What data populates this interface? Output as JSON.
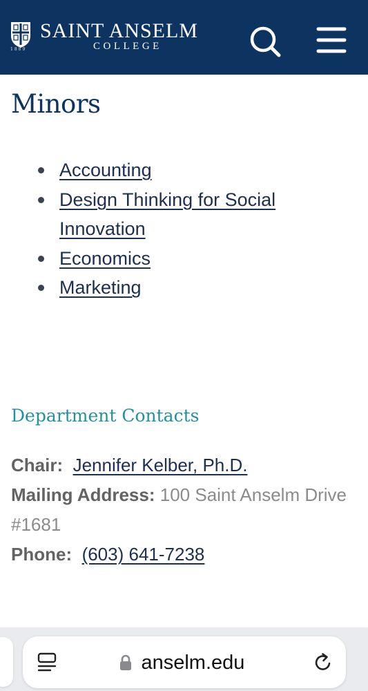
{
  "header": {
    "logo_name": "SAINT ANSELM",
    "logo_sub": "COLLEGE",
    "logo_year": "1889",
    "background_color": "#0d3361",
    "search_icon": "search-icon",
    "menu_icon": "hamburger-menu-icon"
  },
  "main": {
    "title": "Minors",
    "minors": [
      {
        "label": "Accounting"
      },
      {
        "label": "Design Thinking for Social Innovation"
      },
      {
        "label": "Economics"
      },
      {
        "label": "Marketing"
      }
    ],
    "contacts_heading": "Department Contacts",
    "contacts": {
      "chair_label": "Chair:",
      "chair_value": "Jennifer Kelber, Ph.D.",
      "mailing_label": "Mailing Address:",
      "mailing_value": "100 Saint Anselm Drive #1681",
      "phone_label": "Phone:",
      "phone_value": "(603) 641-7238"
    }
  },
  "browser": {
    "url": "anselm.edu",
    "tabs_icon": "tab-overview-icon",
    "lock_icon": "lock-icon",
    "reload_icon": "reload-icon"
  },
  "colors": {
    "navy": "#0d3361",
    "link": "#1c2f52",
    "teal_heading": "#21909f",
    "body_gray": "#8b8b8b"
  }
}
